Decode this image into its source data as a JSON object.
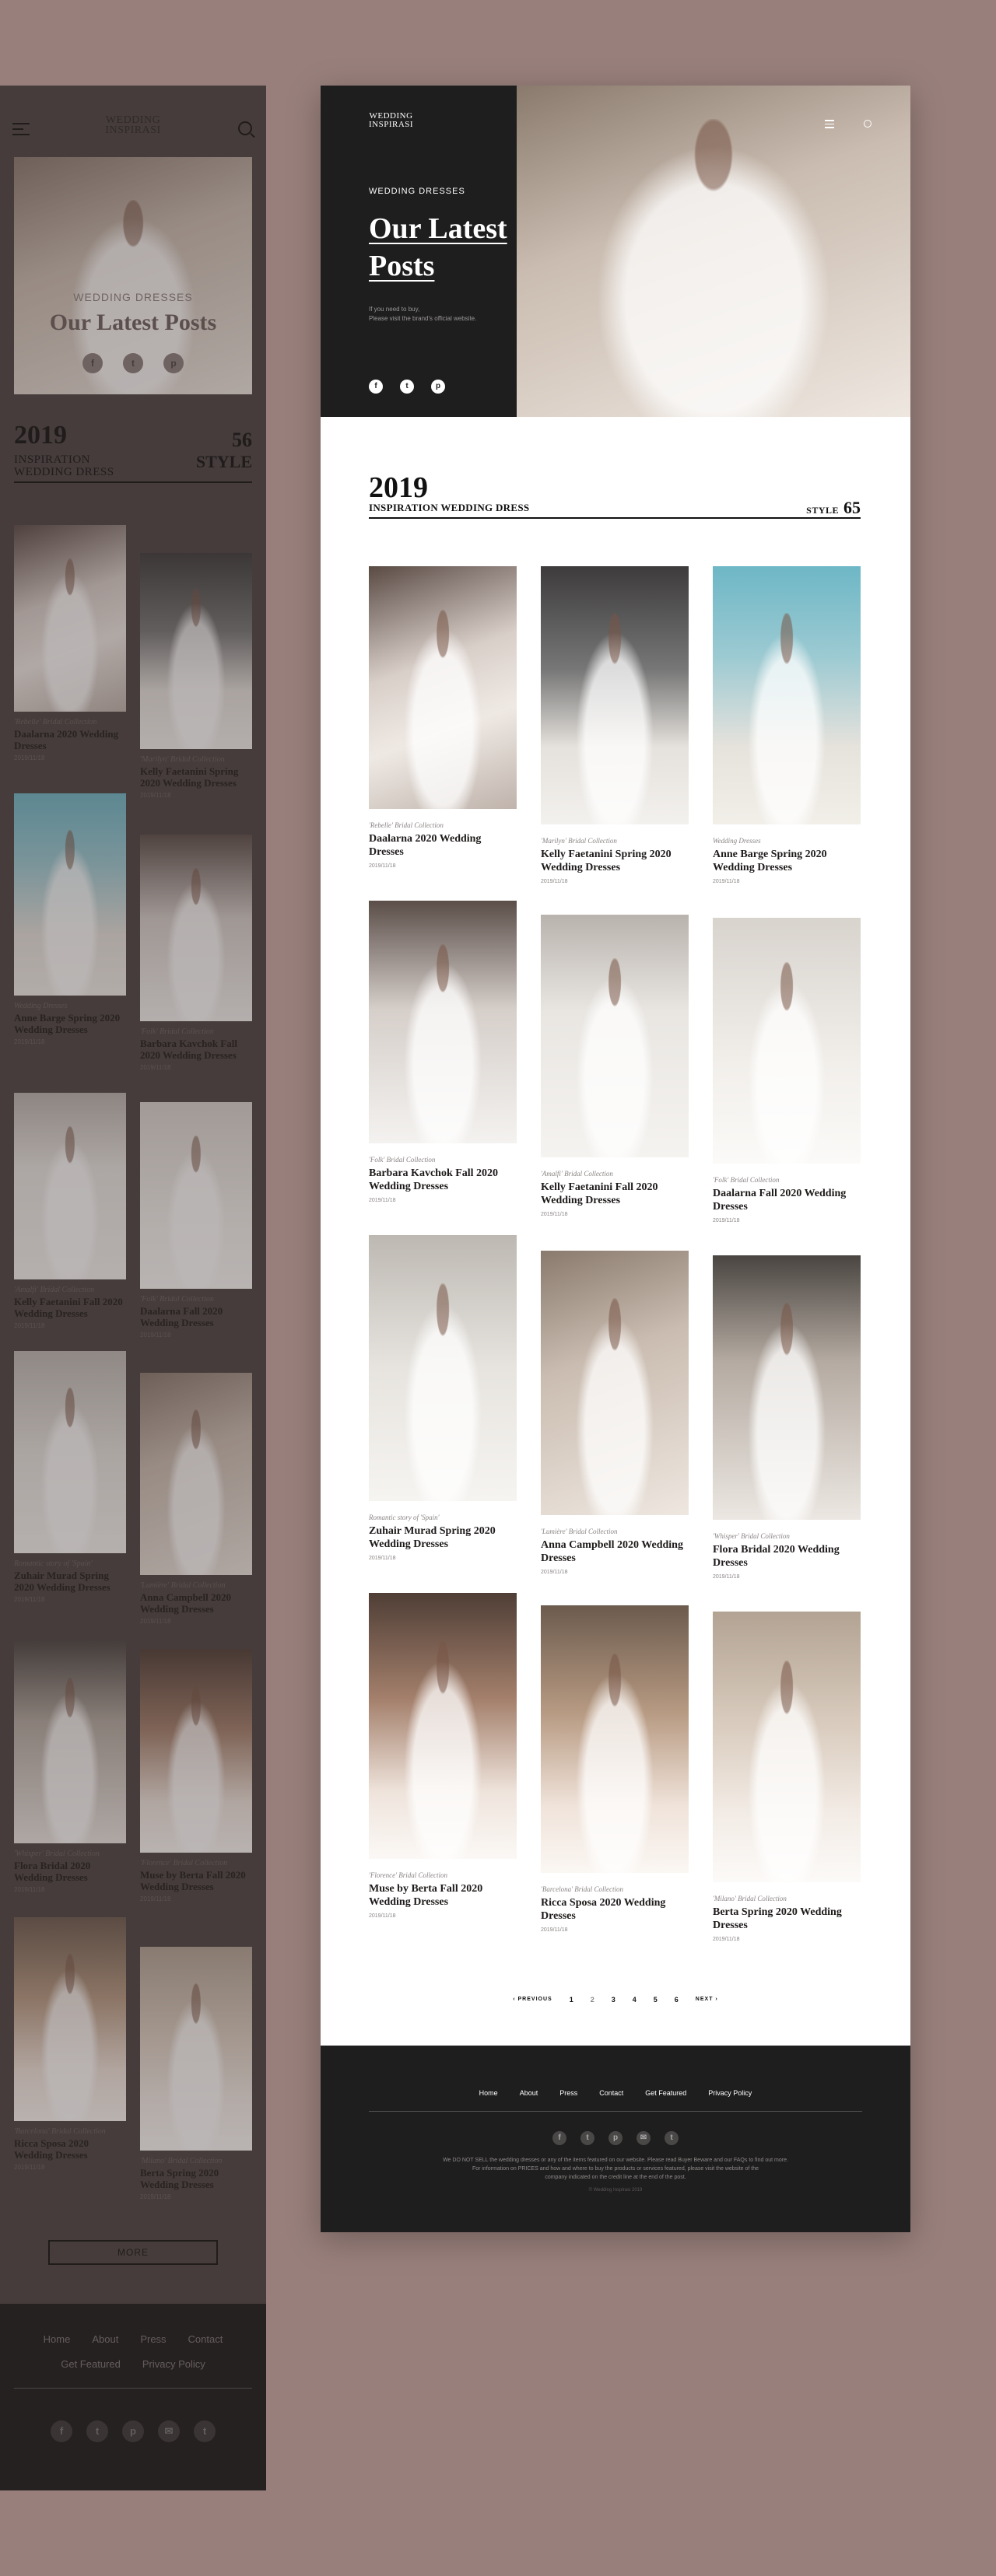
{
  "brand": {
    "logo_line1": "WEDDING",
    "logo_line2": "INSPIRASI"
  },
  "mobile": {
    "hero": {
      "kicker": "WEDDING DRESSES",
      "title": "Our Latest Posts"
    },
    "stats": {
      "year": "2019",
      "line1": "INSPIRATION",
      "line2": "WEDDING DRESS",
      "count": "56",
      "count_label": "STYLE"
    },
    "posts": [
      {
        "collection": "'Rebelle' Bridal Collection",
        "name": "Daalarna 2020 Wedding Dresses",
        "date": "2019/11/18"
      },
      {
        "collection": "'Marilyn' Bridal Collection",
        "name": "Kelly Faetanini Spring 2020 Wedding Dresses",
        "date": "2019/11/18"
      },
      {
        "collection": "Wedding Dresses",
        "name": "Anne Barge Spring 2020 Wedding Dresses",
        "date": "2019/11/18"
      },
      {
        "collection": "'Folk' Bridal Collection",
        "name": "Barbara Kavchok Fall 2020 Wedding Dresses",
        "date": "2019/11/18"
      },
      {
        "collection": "'Amalfi' Bridal Collection",
        "name": "Kelly Faetanini Fall 2020 Wedding Dresses",
        "date": "2019/11/18"
      },
      {
        "collection": "'Folk' Bridal Collection",
        "name": "Daalarna Fall 2020 Wedding Dresses",
        "date": "2019/11/18"
      },
      {
        "collection": "Romantic story of 'Spain'",
        "name": "Zuhair Murad Spring 2020 Wedding Dresses",
        "date": "2019/11/18"
      },
      {
        "collection": "'Lumière' Bridal Collection",
        "name": "Anna Campbell 2020 Wedding Dresses",
        "date": "2019/11/18"
      },
      {
        "collection": "'Whisper' Bridal Collection",
        "name": "Flora Bridal 2020 Wedding Dresses",
        "date": "2019/11/18"
      },
      {
        "collection": "'Florence' Bridal Collection",
        "name": "Muse by Berta Fall 2020 Wedding Dresses",
        "date": "2019/11/18"
      },
      {
        "collection": "'Barcelona' Bridal Collection",
        "name": "Ricca Sposa 2020 Wedding Dresses",
        "date": "2019/11/18"
      },
      {
        "collection": "'Milano' Bridal Collection",
        "name": "Berta Spring 2020 Wedding Dresses",
        "date": "2019/11/18"
      }
    ],
    "more_label": "MORE",
    "footer": {
      "links_row1": [
        "Home",
        "About",
        "Press",
        "Contact"
      ],
      "links_row2": [
        "Get Featured",
        "Privacy Policy"
      ]
    }
  },
  "desktop": {
    "hero": {
      "kicker": "WEDDING DRESSES",
      "title_line1": "Our Latest",
      "title_line2": "Posts",
      "desc_line1": "If you need to buy,",
      "desc_line2": "Please visit the brand's official website."
    },
    "stats": {
      "year": "2019",
      "subtitle": "INSPIRATION WEDDING DRESS",
      "count_label": "STYLE",
      "count": "65"
    },
    "posts": [
      {
        "collection": "'Rebelle' Bridal Collection",
        "name": "Daalarna 2020 Wedding Dresses",
        "date": "2019/11/18"
      },
      {
        "collection": "'Marilyn' Bridal Collection",
        "name": "Kelly Faetanini Spring 2020 Wedding Dresses",
        "date": "2019/11/18"
      },
      {
        "collection": "Wedding Dresses",
        "name": "Anne Barge Spring 2020 Wedding Dresses",
        "date": "2019/11/18"
      },
      {
        "collection": "'Folk' Bridal Collection",
        "name": "Barbara Kavchok Fall 2020 Wedding Dresses",
        "date": "2019/11/18"
      },
      {
        "collection": "'Amalfi' Bridal Collection",
        "name": "Kelly Faetanini Fall 2020 Wedding Dresses",
        "date": "2019/11/18"
      },
      {
        "collection": "'Folk' Bridal Collection",
        "name": "Daalarna Fall 2020 Wedding Dresses",
        "date": "2019/11/18"
      },
      {
        "collection": "Romantic story of 'Spain'",
        "name": "Zuhair Murad Spring 2020 Wedding Dresses",
        "date": "2019/11/18"
      },
      {
        "collection": "'Lumière' Bridal Collection",
        "name": "Anna Campbell 2020 Wedding Dresses",
        "date": "2019/11/18"
      },
      {
        "collection": "'Whisper' Bridal Collection",
        "name": "Flora Bridal 2020 Wedding Dresses",
        "date": "2019/11/18"
      },
      {
        "collection": "'Florence' Bridal Collection",
        "name": "Muse by Berta Fall 2020 Wedding Dresses",
        "date": "2019/11/18"
      },
      {
        "collection": "'Barcelona' Bridal Collection",
        "name": "Ricca Sposa 2020 Wedding Dresses",
        "date": "2019/11/18"
      },
      {
        "collection": "'Milano' Bridal Collection",
        "name": "Berta Spring 2020 Wedding Dresses",
        "date": "2019/11/18"
      }
    ],
    "pagination": {
      "prev": "PREVIOUS",
      "pages": [
        "1",
        "2",
        "3",
        "4",
        "5",
        "6"
      ],
      "current": "2",
      "next": "NEXT"
    },
    "footer": {
      "links": [
        "Home",
        "About",
        "Press",
        "Contact",
        "Get Featured",
        "Privacy Policy"
      ],
      "note_line1": "We DO NOT SELL the wedding dresses or any of the items featured on our website. Please read Buyer Beware and our FAQs to find out more.",
      "note_line2": "For information on PRICES and how and where to buy the products or services featured, please visit the website of the",
      "note_line3": "company indicated on the credit line at the end of the post.",
      "copyright": "© Wedding Inspirasi 2019"
    }
  },
  "social_icons": [
    "facebook-icon",
    "twitter-icon",
    "pinterest-icon",
    "email-icon",
    "tumblr-icon"
  ],
  "colors": {
    "background": "#987f7b",
    "dark": "#1e1e1e",
    "accent_text": "#111111"
  }
}
